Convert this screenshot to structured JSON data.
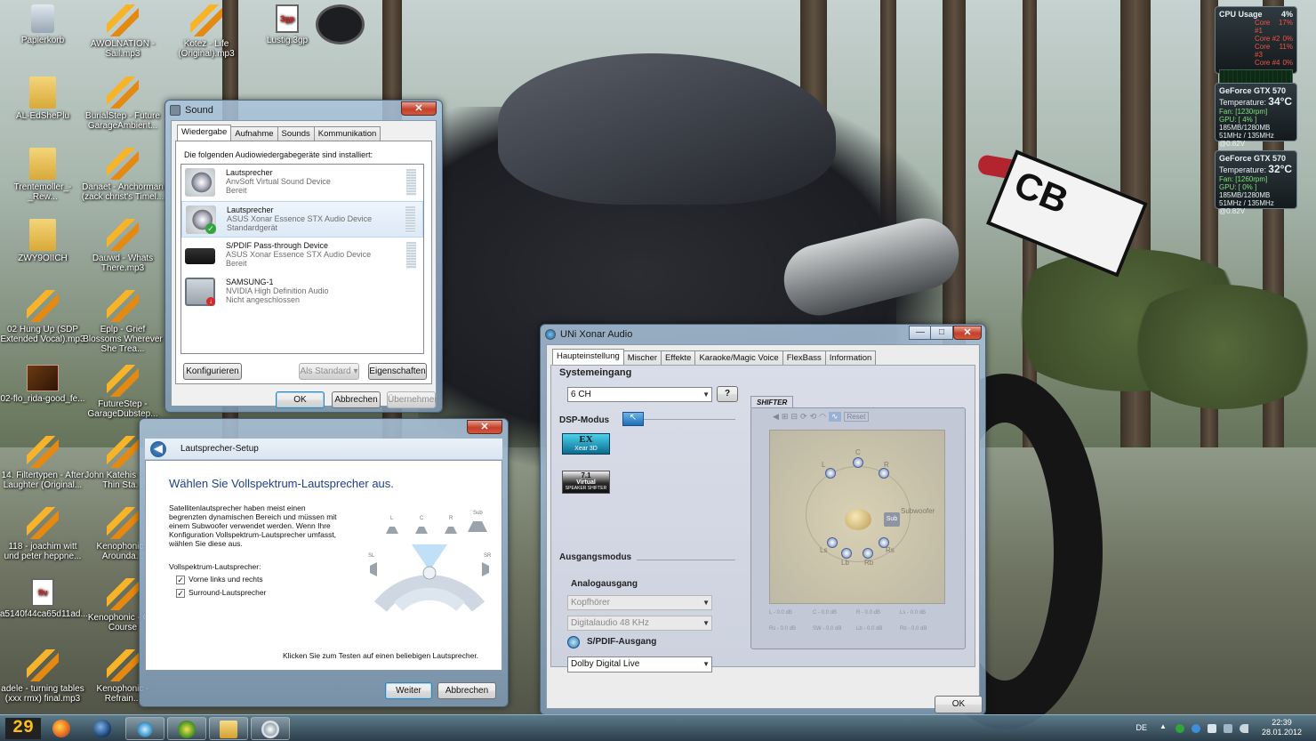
{
  "desktop_icons": [
    {
      "label": "Papierkorb",
      "kind": "bin"
    },
    {
      "label": "AWOLNATION - Sail.mp3",
      "kind": "bolt"
    },
    {
      "label": "Kotez - Life (Original).mp3",
      "kind": "bolt"
    },
    {
      "label": "Lustig.3gp",
      "kind": "vid",
      "top_label": "3gp"
    },
    {
      "label": "AL-EdShePlu",
      "kind": "folder"
    },
    {
      "label": "BurialStep - Future GarageAmbient...",
      "kind": "bolt"
    },
    {
      "label": "Trentemoller_-_Rew...",
      "kind": "folder"
    },
    {
      "label": "Danaet - Anchorman (zack christ's Timel...",
      "kind": "bolt"
    },
    {
      "label": "ZWY9OIICH",
      "kind": "folder"
    },
    {
      "label": "Dauwd - Whats There.mp3",
      "kind": "bolt"
    },
    {
      "label": "02 Hung Up (SDP Extended Vocal).mp3",
      "kind": "bolt"
    },
    {
      "label": "Eplp - Grief Blossoms Wherever She Trea...",
      "kind": "bolt"
    },
    {
      "label": "02-flo_rida-good_fe...",
      "kind": "game"
    },
    {
      "label": "FutureStep - GarageDubstep...",
      "kind": "bolt"
    },
    {
      "label": "14. Filtertypen - After Laughter (Original...",
      "kind": "bolt"
    },
    {
      "label": "John Katehis - This Thin Sta...",
      "kind": "bolt"
    },
    {
      "label": "118 - joachim witt und peter heppne...",
      "kind": "bolt"
    },
    {
      "label": "Kenophonic - Arounda...",
      "kind": "bolt"
    },
    {
      "label": "a5140f44ca65d11ad...",
      "kind": "vid",
      "top_label": "flv"
    },
    {
      "label": "Kenophonic - Off-Course",
      "kind": "bolt"
    },
    {
      "label": "adele - turning tables (xxx rmx) final.mp3",
      "kind": "bolt"
    },
    {
      "label": "Kenophonic - Refrain...",
      "kind": "bolt"
    }
  ],
  "background": {
    "plate_text": "CB"
  },
  "gadgets": {
    "cpu": {
      "title": "CPU Usage",
      "total": "4%",
      "cores": [
        {
          "name": "Core #1",
          "val": "17%"
        },
        {
          "name": "Core #2",
          "val": "0%"
        },
        {
          "name": "Core #3",
          "val": "11%"
        },
        {
          "name": "Core #4",
          "val": "0%"
        }
      ]
    },
    "gpu1": {
      "title": "GeForce GTX 570",
      "temp_label": "Temperature:",
      "temp": "34°C",
      "fan": "Fan: [1230rpm]",
      "gpu": "GPU: [ 4% ]",
      "mem": "185MB/1280MB",
      "clock": "51MHz / 135MHz @0.82V"
    },
    "gpu2": {
      "title": "GeForce GTX 570",
      "temp_label": "Temperature:",
      "temp": "32°C",
      "fan": "Fan: [1260rpm]",
      "gpu": "GPU: [ 0% ]",
      "mem": "185MB/1280MB",
      "clock": "51MHz / 135MHz @0.82V"
    }
  },
  "sound": {
    "title": "Sound",
    "close": "✕",
    "tabs": [
      "Wiedergabe",
      "Aufnahme",
      "Sounds",
      "Kommunikation"
    ],
    "intro": "Die folgenden Audiowiedergabegeräte sind installiert:",
    "devices": [
      {
        "name": "Lautsprecher",
        "desc": "AnvSoft Virtual Sound Device",
        "state": "Bereit"
      },
      {
        "name": "Lautsprecher",
        "desc": "ASUS Xonar Essence STX Audio Device",
        "state": "Standardgerät"
      },
      {
        "name": "S/PDIF Pass-through Device",
        "desc": "ASUS Xonar Essence STX Audio Device",
        "state": "Bereit"
      },
      {
        "name": "SAMSUNG-1",
        "desc": "NVIDIA High Definition Audio",
        "state": "Nicht angeschlossen"
      }
    ],
    "configure": "Konfigurieren",
    "set_default": "Als Standard",
    "properties": "Eigenschaften",
    "ok": "OK",
    "cancel": "Abbrechen",
    "apply": "Übernehmen"
  },
  "setup": {
    "title": "Lautsprecher-Setup",
    "close": "✕",
    "back": "◀",
    "heading": "Wählen Sie Vollspektrum-Lautsprecher aus.",
    "paragraph": "Satellitenlautsprecher haben meist einen begrenzten dynamischen Bereich und müssen mit einem Subwoofer verwendet werden. Wenn Ihre Konfiguration Vollspektrum-Lautsprecher umfasst, wählen Sie diese aus.",
    "group_label": "Vollspektrum-Lautsprecher:",
    "opt_front": "Vorne links und rechts",
    "opt_surround": "Surround-Lautsprecher",
    "check": "✓",
    "hint": "Klicken Sie zum Testen auf einen beliebigen Lautsprecher.",
    "next": "Weiter",
    "cancel": "Abbrechen",
    "diagram_labels": {
      "l": "L",
      "c": "C",
      "r": "R",
      "sub": "Sub",
      "sl": "SL",
      "sr": "SR"
    }
  },
  "xonar": {
    "title": "UNi Xonar Audio",
    "min": "—",
    "max": "□",
    "close": "✕",
    "tabs": [
      "Haupteinstellung",
      "Mischer",
      "Effekte",
      "Karaoke/Magic Voice",
      "FlexBass",
      "Information"
    ],
    "system_input_label": "Systemeingang",
    "system_input_value": "6 CH",
    "help": "?",
    "dsp_label": "DSP-Modus",
    "xear_line1": "EX",
    "xear_line2": "Xear 3D",
    "virtual_line1": "7.1",
    "virtual_line2": "Virtual",
    "virtual_line3": "SPEAKER SHIFTER",
    "output_mode_label": "Ausgangsmodus",
    "analog_label": "Analogausgang",
    "analog_value": "Kopfhörer",
    "digital_value": "Digitalaudio  48 KHz",
    "spdif_label": "S/PDIF-Ausgang",
    "spdif_value": "Dolby Digital Live",
    "shifter_label": "SHIFTER",
    "reset": "Reset",
    "stage_labels": {
      "c": "C",
      "l": "L",
      "r": "R",
      "sub": "Sub",
      "subwoofer": "Subwoofer",
      "ls": "Ls",
      "rs": "Rs",
      "lb": "Lb",
      "rb": "Rb"
    },
    "levels": [
      "L - 0.0 dB",
      "C - 0.0 dB",
      "R - 0.0 dB",
      "Ls - 0.0 dB",
      "Rs - 0.0 dB",
      "SW - 0.0 dB",
      "Lb - 0.0 dB",
      "Rb - 0.0 dB"
    ],
    "ok": "OK"
  },
  "taskbar": {
    "day": "29",
    "lang": "DE",
    "time": "22:39",
    "date": "28.01.2012"
  }
}
